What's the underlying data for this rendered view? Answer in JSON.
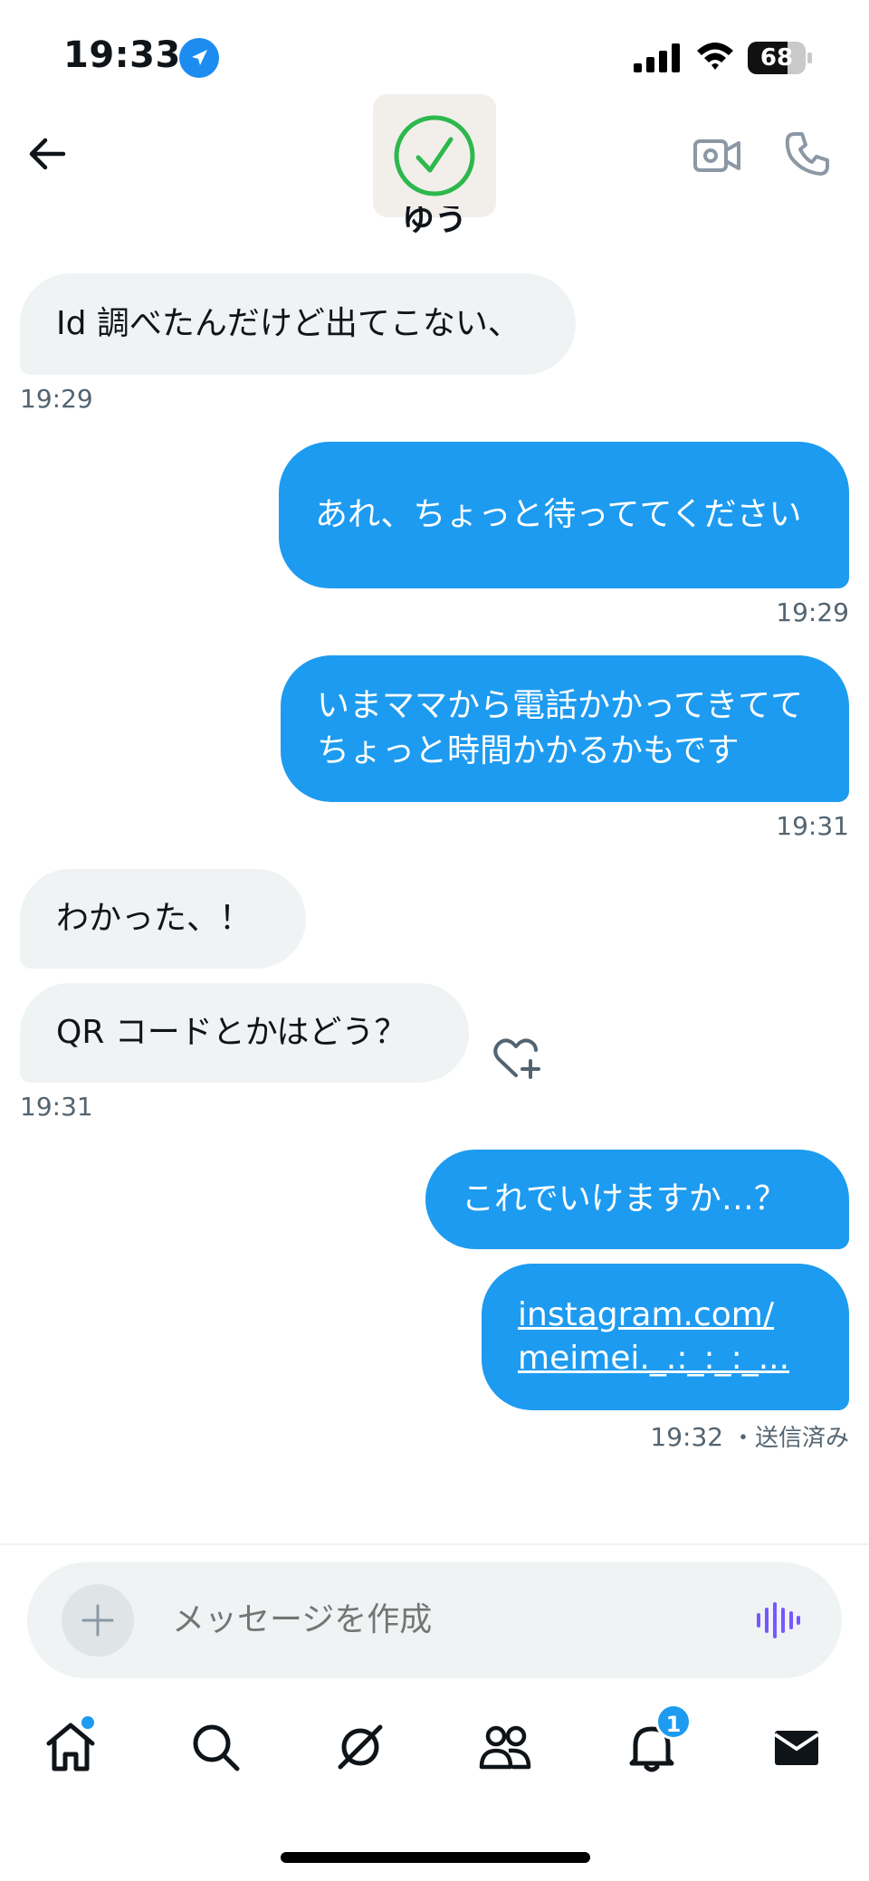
{
  "status_bar": {
    "time": "19:33",
    "battery_level": "68",
    "battery_fraction": 0.68
  },
  "header": {
    "contact_name": "ゆう"
  },
  "messages": [
    {
      "text": "Id 調べたんだけど出てこない、",
      "time": "19:29"
    },
    {
      "text": "あれ、ちょっと待っててください",
      "time": "19:29"
    },
    {
      "text": "いまママから電話かかってきててちょっと時間かかるかもです",
      "time": "19:31"
    },
    {
      "text": "わかった、！"
    },
    {
      "text": "QR コードとかはどう？",
      "time": "19:31"
    },
    {
      "text": "これでいけますか…？"
    },
    {
      "text_line1": "instagram.com/",
      "text_line2": "meimei._.:_:_:_...",
      "time": "19:32",
      "status": "・送信済み"
    }
  ],
  "composer": {
    "placeholder": "メッセージを作成"
  },
  "tabbar": {
    "notification_count": "1"
  },
  "colors": {
    "accent": "#1d9bf0",
    "incoming_bubble": "#eff3f4",
    "verified_green": "#2db84d",
    "voice_purple": "#7856ff"
  }
}
